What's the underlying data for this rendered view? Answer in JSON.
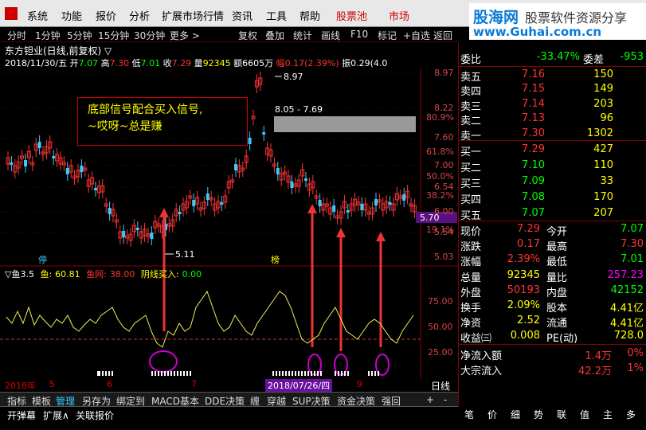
{
  "menu": {
    "items": [
      "系统",
      "功能",
      "报价",
      "分析",
      "扩展市场行情",
      "资讯",
      "工具",
      "帮助",
      "股票池",
      "市场"
    ]
  },
  "brand": {
    "title": "股海网",
    "subtitle": "股票软件资源分享",
    "url": "www.Guhai.com.cn"
  },
  "toolbar": {
    "periods": [
      "分时",
      "1分钟",
      "5分钟",
      "15分钟",
      "30分钟",
      "更多 >"
    ],
    "tools": [
      "复权",
      "叠加",
      "统计",
      "画线",
      "F10",
      "标记",
      "+自选",
      "返回"
    ]
  },
  "stock": {
    "name": "东方钽业(日线,前复权) ▽",
    "date": "2018/11/30/五",
    "open_label": "开",
    "open": "7.07",
    "high_label": "高",
    "high": "7.30",
    "low_label": "低",
    "low": "7.01",
    "close_label": "收",
    "close": "7.29",
    "vol_label": "量",
    "vol": "92345",
    "amt_label": "额",
    "amt": "6605万",
    "chg_label": "幅",
    "chg": "0.17(2.39%)",
    "amp_label": "振",
    "amp": "0.29(4.0"
  },
  "annotation": {
    "line1": "底部信号配合买入信号,",
    "line2": "~哎呀~总是赚"
  },
  "price_axis": [
    "8.97",
    "8.22",
    "7.60",
    "7.00",
    "6.54",
    "6.00",
    "5.54",
    "5.03"
  ],
  "pct_axis": [
    "80.9%",
    "61.8%",
    "50.0%",
    "38.2%",
    "19.1%"
  ],
  "chart_labels": {
    "high_mark": "8.97",
    "low_mark": "5.11",
    "gap_label": "8.05 - 7.69",
    "cur_price": "5.70",
    "tag1": "停",
    "tag2": "榜"
  },
  "indicator": {
    "name": "▽鱼3.5",
    "val_label": "鱼:",
    "val": "60.81",
    "net_label": "鱼网:",
    "net": "38.00",
    "buy_label": "阴线买入:",
    "buy": "0.00",
    "axis": [
      "75.00",
      "50.00",
      "25.00"
    ]
  },
  "datebar": {
    "labels": [
      "2018年",
      "5",
      "6",
      "7",
      "9"
    ],
    "highlight": "2018/07/26/四",
    "period": "日线"
  },
  "bottom_tabs": [
    "指标",
    "模板",
    "管理",
    "另存为",
    "绑定到",
    "MACD基本",
    "DDE决策",
    "缠",
    "穿越",
    "SUP决策",
    "资金决策",
    "强回",
    "+",
    "-"
  ],
  "bottom_tabs2": [
    "开弹幕",
    "扩展∧",
    "关联报价"
  ],
  "quote": {
    "weibi_label": "委比",
    "weibi": "-33.47%",
    "weicha_label": "委差",
    "weicha": "-953",
    "sell": [
      {
        "label": "卖五",
        "price": "7.16",
        "vol": "150"
      },
      {
        "label": "卖四",
        "price": "7.15",
        "vol": "149"
      },
      {
        "label": "卖三",
        "price": "7.14",
        "vol": "203"
      },
      {
        "label": "卖二",
        "price": "7.13",
        "vol": "96"
      },
      {
        "label": "卖一",
        "price": "7.30",
        "vol": "1302"
      }
    ],
    "buy": [
      {
        "label": "买一",
        "price": "7.29",
        "vol": "427"
      },
      {
        "label": "买二",
        "price": "7.10",
        "vol": "110"
      },
      {
        "label": "买三",
        "price": "7.09",
        "vol": "33"
      },
      {
        "label": "买四",
        "price": "7.08",
        "vol": "170"
      },
      {
        "label": "买五",
        "price": "7.07",
        "vol": "207"
      }
    ],
    "stats": [
      {
        "l1": "现价",
        "v1": "7.29",
        "c1": "#f33",
        "l2": "今开",
        "v2": "7.07",
        "c2": "#0f0"
      },
      {
        "l1": "涨跌",
        "v1": "0.17",
        "c1": "#f33",
        "l2": "最高",
        "v2": "7.30",
        "c2": "#f33"
      },
      {
        "l1": "涨幅",
        "v1": "2.39%",
        "c1": "#f33",
        "l2": "最低",
        "v2": "7.01",
        "c2": "#0f0"
      },
      {
        "l1": "总量",
        "v1": "92345",
        "c1": "#ff0",
        "l2": "量比",
        "v2": "257.23",
        "c2": "#f0f"
      },
      {
        "l1": "外盘",
        "v1": "50193",
        "c1": "#f33",
        "l2": "内盘",
        "v2": "42152",
        "c2": "#0f0"
      },
      {
        "l1": "换手",
        "v1": "2.09%",
        "c1": "#ff0",
        "l2": "股本",
        "v2": "4.41亿",
        "c2": "#ff0"
      },
      {
        "l1": "净资",
        "v1": "2.52",
        "c1": "#ff0",
        "l2": "流通",
        "v2": "4.41亿",
        "c2": "#ff0"
      },
      {
        "l1": "收益㈢",
        "v1": "0.008",
        "c1": "#ff0",
        "l2": "PE(动)",
        "v2": "728.0",
        "c2": "#ff0"
      }
    ],
    "flow": [
      {
        "label": "净流入额",
        "v1": "1.4万",
        "v2": "0%"
      },
      {
        "label": "大宗流入",
        "v1": "42.2万",
        "v2": "1%"
      }
    ]
  },
  "right_tabs": [
    "笔",
    "价",
    "细",
    "势",
    "联",
    "值",
    "主",
    "多"
  ]
}
